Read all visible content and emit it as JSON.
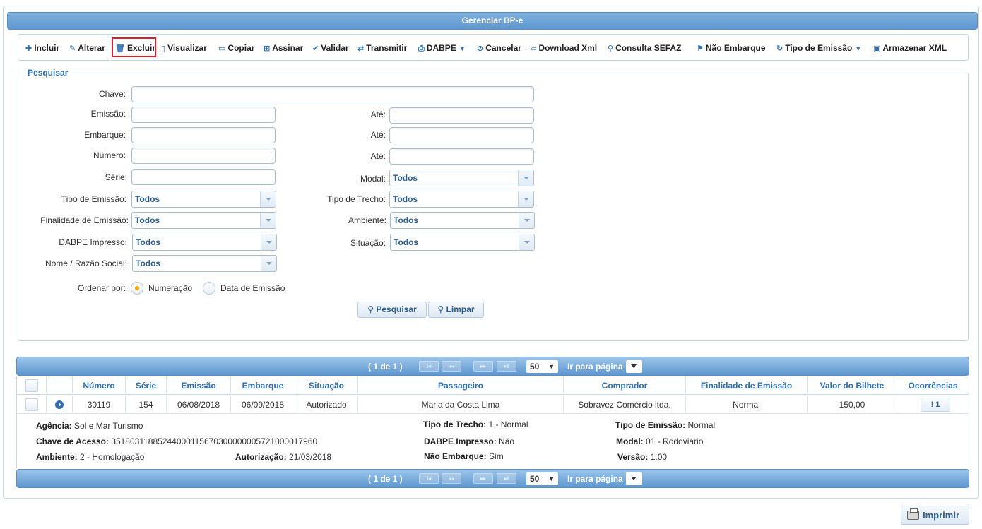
{
  "title": "Gerenciar BP-e",
  "toolbar": {
    "incluir": "Incluir",
    "alterar": "Alterar",
    "excluir": "Excluir",
    "visualizar": "Visualizar",
    "copiar": "Copiar",
    "assinar": "Assinar",
    "validar": "Validar",
    "transmitir": "Transmitir",
    "dabpe": "DABPE",
    "cancelar": "Cancelar",
    "download_xml": "Download Xml",
    "consulta_sefaz": "Consulta SEFAZ",
    "nao_embarque": "Não Embarque",
    "tipo_emissao": "Tipo de Emissão",
    "armazenar_xml": "Armazenar XML"
  },
  "search": {
    "legend": "Pesquisar",
    "chave_label": "Chave:",
    "emissao_label": "Emissão:",
    "embarque_label": "Embarque:",
    "numero_label": "Número:",
    "serie_label": "Série:",
    "ate_label": "Até:",
    "modal_label": "Modal:",
    "modal_value": "Todos",
    "tipo_emissao_label": "Tipo de Emissão:",
    "tipo_emissao_value": "Todos",
    "tipo_trecho_label": "Tipo de Trecho:",
    "tipo_trecho_value": "Todos",
    "finalidade_label": "Finalidade de Emissão:",
    "finalidade_value": "Todos",
    "ambiente_label": "Ambiente:",
    "ambiente_value": "Todos",
    "dabpe_impresso_label": "DABPE Impresso:",
    "dabpe_impresso_value": "Todos",
    "situacao_label": "Situação:",
    "situacao_value": "Todos",
    "nome_label": "Nome / Razão Social:",
    "nome_value": "Todos",
    "ordenar_label": "Ordenar por:",
    "ordenar_options": [
      "Numeração",
      "Data de Emissão"
    ],
    "ordenar_selected": "Numeração",
    "pesquisar_button": "Pesquisar",
    "limpar_button": "Limpar"
  },
  "pager": {
    "page_text": "( 1 de 1 )",
    "first": "I◂",
    "prev": "◂◂",
    "next": "▸▸",
    "last": "▸I",
    "page_size": "50",
    "goto_label": "Ir para página"
  },
  "table": {
    "columns": [
      "Número",
      "Série",
      "Emissão",
      "Embarque",
      "Situação",
      "Passageiro",
      "Comprador",
      "Finalidade de Emissão",
      "Valor do Bilhete",
      "Ocorrências"
    ],
    "row": {
      "numero": "30119",
      "serie": "154",
      "emissao": "06/08/2018",
      "embarque": "06/09/2018",
      "situacao": "Autorizado",
      "passageiro": "Maria da Costa Lima",
      "comprador": "Sobravez Comércio ltda.",
      "finalidade": "Normal",
      "valor": "150,00",
      "ocorrencias": "1",
      "ocorrencias_icon": "!"
    },
    "detail": {
      "agencia_label": "Agência:",
      "agencia_value": "Sol e Mar Turismo",
      "chave_label": "Chave de Acesso:",
      "chave_value": "35180311885244000115670300000005721000017960",
      "ambiente_label": "Ambiente:",
      "ambiente_value": "2 - Homologação",
      "autorizacao_label": "Autorização:",
      "autorizacao_value": "21/03/2018",
      "tipo_trecho_label": "Tipo de Trecho:",
      "tipo_trecho_value": "1 - Normal",
      "dabpe_label": "DABPE Impresso:",
      "dabpe_value": "Não",
      "nao_embarque_label": "Não Embarque:",
      "nao_embarque_value": "Sim",
      "tipo_emissao_label": "Tipo de Emissão:",
      "tipo_emissao_value": "Normal",
      "modal_label": "Modal:",
      "modal_value": "01 - Rodoviário",
      "versao_label": "Versão:",
      "versao_value": "1.00"
    }
  },
  "print_button": "Imprimir"
}
